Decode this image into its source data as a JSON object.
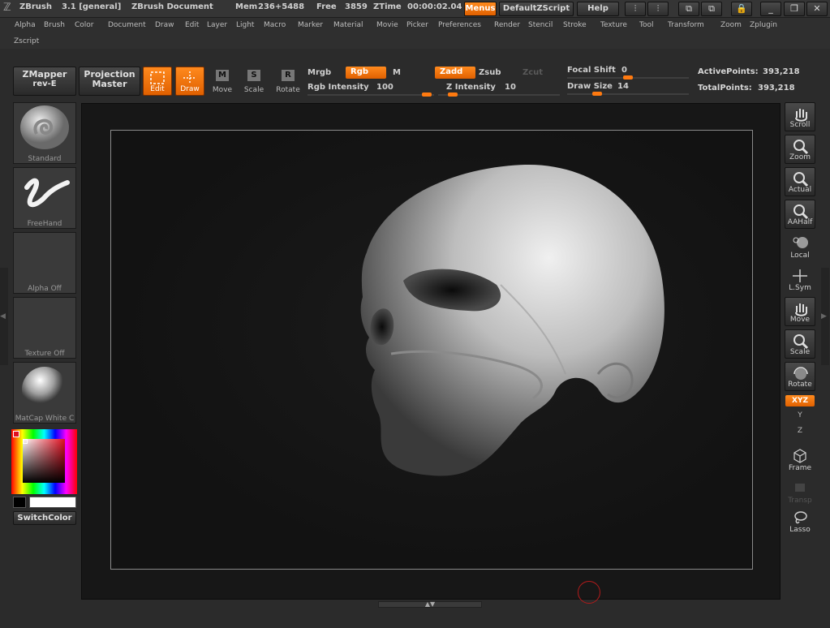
{
  "titlebar": {
    "app_name": "ZBrush",
    "version": "3.1 [general]",
    "document_title": "ZBrush Document",
    "mem_label": "Mem",
    "mem_value": "236+5488",
    "free_label": "Free",
    "free_value": "3859",
    "ztime_label": "ZTime",
    "ztime_value": "00:00:02.04",
    "menus_button": "Menus",
    "script_button": "DefaultZScript",
    "help_button": "Help"
  },
  "menubar": {
    "items": [
      "Alpha",
      "Brush",
      "Color",
      "Document",
      "Draw",
      "Edit",
      "Layer",
      "Light",
      "Macro",
      "Marker",
      "Material",
      "Movie",
      "Picker",
      "Preferences",
      "Render",
      "Stencil",
      "Stroke",
      "Texture",
      "Tool",
      "Transform",
      "Zoom",
      "Zplugin",
      "Zscript"
    ]
  },
  "toolbar": {
    "zmapper": "ZMapper",
    "zmapper_rev": "rev-E",
    "projection": "Projection",
    "projection_master": "Master",
    "edit": "Edit",
    "draw": "Draw",
    "move": "Move",
    "scale": "Scale",
    "rotate": "Rotate",
    "move_key": "M",
    "scale_key": "S",
    "rotate_key": "R",
    "mrgb": "Mrgb",
    "rgb": "Rgb",
    "m": "M",
    "rgb_intensity_label": "Rgb Intensity",
    "rgb_intensity_value": "100",
    "zadd": "Zadd",
    "zsub": "Zsub",
    "zcut": "Zcut",
    "z_intensity_label": "Z Intensity",
    "z_intensity_value": "10",
    "focal_shift_label": "Focal Shift",
    "focal_shift_value": "0",
    "draw_size_label": "Draw Size",
    "draw_size_value": "14",
    "active_points_label": "ActivePoints:",
    "active_points_value": "393,218",
    "total_points_label": "TotalPoints:",
    "total_points_value": "393,218"
  },
  "left_shelf": {
    "brush": "Standard",
    "stroke": "FreeHand",
    "alpha": "Alpha Off",
    "texture": "Texture Off",
    "material": "MatCap White C",
    "switch_color": "SwitchColor"
  },
  "right_shelf": {
    "scroll": "Scroll",
    "zoom": "Zoom",
    "actual": "Actual",
    "aahalf": "AAHalf",
    "local": "Local",
    "lsym": "L.Sym",
    "move": "Move",
    "scale": "Scale",
    "rotate": "Rotate",
    "xyz": "XYZ",
    "y": "Y",
    "z": "Z",
    "frame": "Frame",
    "transp": "Transp",
    "lasso": "Lasso"
  },
  "colors": {
    "accent": "#f07010",
    "background": "#2b2b2b",
    "canvas": "#171717"
  }
}
